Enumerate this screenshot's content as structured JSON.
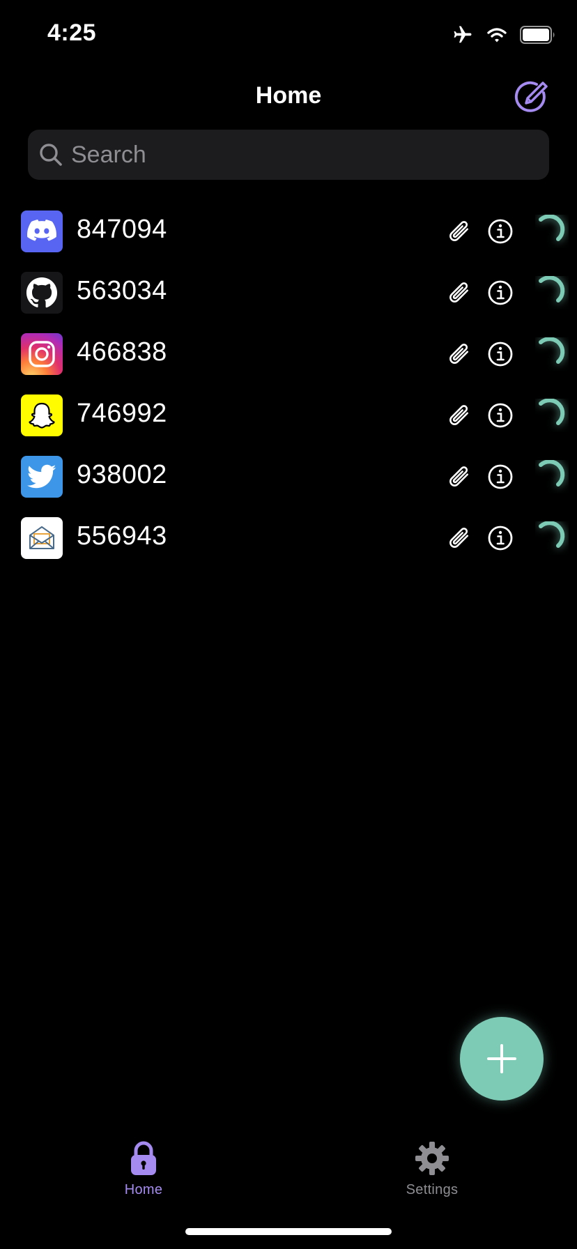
{
  "status_bar": {
    "time": "4:25",
    "icons": [
      "airplane-icon",
      "wifi-icon",
      "battery-icon"
    ]
  },
  "header": {
    "title": "Home",
    "edit_icon": "edit-pencil-circle-icon"
  },
  "search": {
    "placeholder": "Search"
  },
  "accounts": [
    {
      "service": "discord",
      "code": "847094"
    },
    {
      "service": "github",
      "code": "563034"
    },
    {
      "service": "instagram",
      "code": "466838"
    },
    {
      "service": "snapchat",
      "code": "746992"
    },
    {
      "service": "twitter",
      "code": "938002"
    },
    {
      "service": "mail",
      "code": "556943"
    }
  ],
  "row_actions": [
    "paperclip-icon",
    "info-icon",
    "countdown-timer-icon"
  ],
  "fab": {
    "icon": "plus-icon"
  },
  "tabs": [
    {
      "label": "Home",
      "icon": "lock-icon",
      "active": true
    },
    {
      "label": "Settings",
      "icon": "gear-icon",
      "active": false
    }
  ],
  "colors": {
    "accent_purple": "#a58bf0",
    "accent_teal": "#7dcab5",
    "background": "#000000",
    "inactive_tab": "#8e8e93"
  }
}
